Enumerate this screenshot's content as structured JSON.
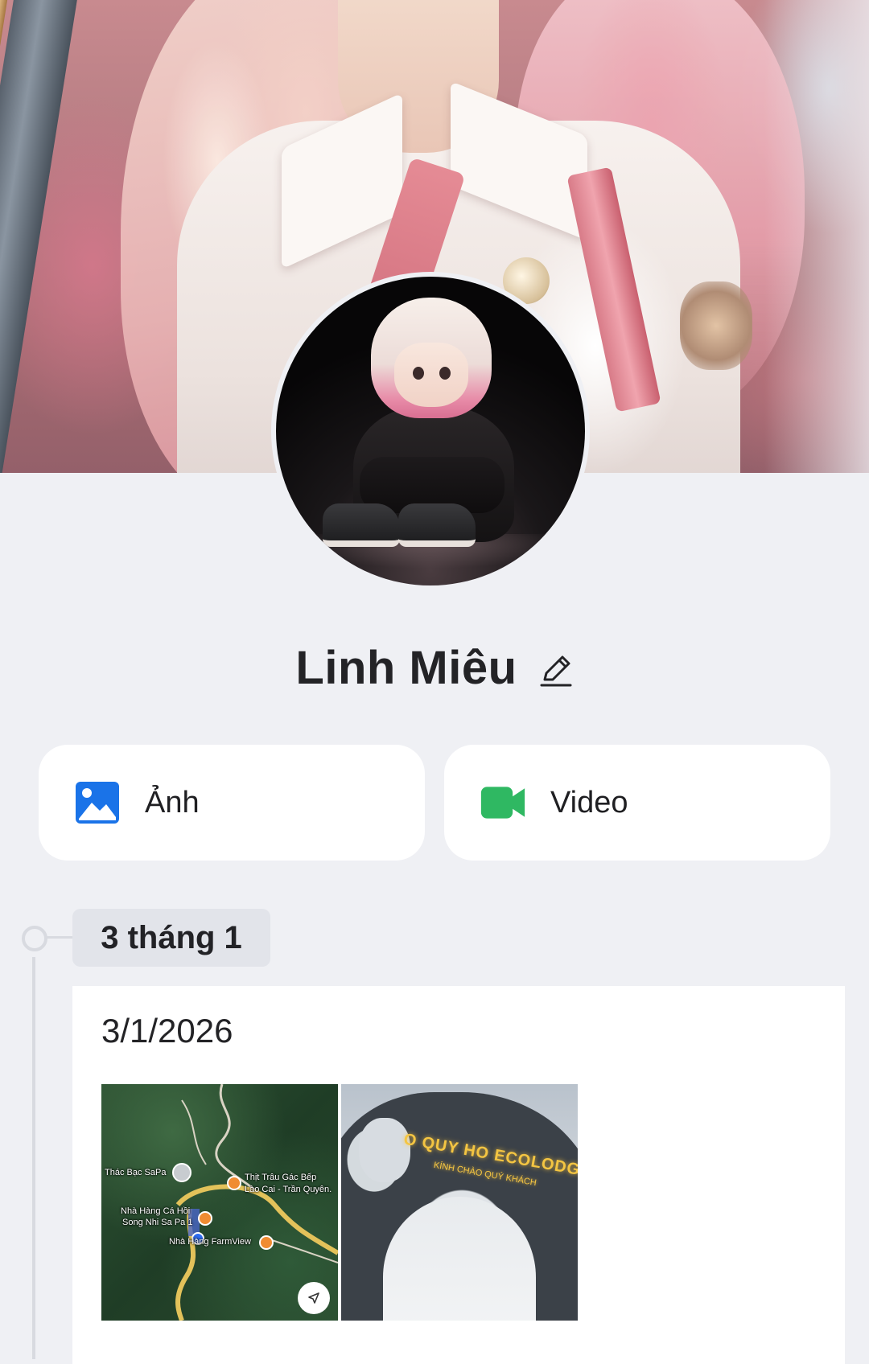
{
  "profile": {
    "name": "Linh Miêu"
  },
  "media_buttons": {
    "photo_label": "Ảnh",
    "video_label": "Video"
  },
  "colors": {
    "photo_icon": "#1a73e8",
    "video_icon": "#2fb862",
    "background": "#eff0f4"
  },
  "timeline": {
    "group_label": "3 tháng 1",
    "posts": [
      {
        "date": "3/1/2026",
        "thumbnails": [
          {
            "kind": "map",
            "labels": {
              "thac_bac": "Thác Bạc SaPa",
              "thit_trau_1": "Thịt Trâu Gác Bếp",
              "thit_trau_2": "Lào Cai - Trần Quyên.",
              "nha_hang_ca_1": "Nhà Hàng Cá Hồi",
              "nha_hang_ca_2": "Song Nhi Sa Pa 1",
              "farmview": "Nhà Hàng FarmView"
            }
          },
          {
            "kind": "photo",
            "sign_main": "O QUY HO ECOLODGE",
            "sign_sub": "KÍNH CHÀO QUÝ KHÁCH"
          }
        ]
      }
    ]
  },
  "icons": [
    "edit-pencil-icon",
    "photo-icon",
    "video-camera-icon",
    "navigation-arrow-icon"
  ]
}
